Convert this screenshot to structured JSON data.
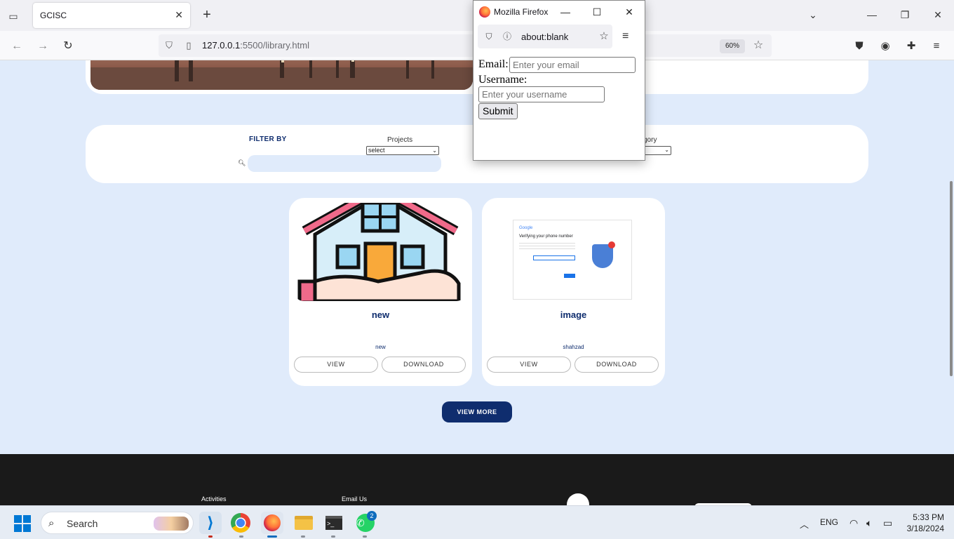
{
  "browser": {
    "tab_title": "GCISC",
    "url_host": "127.0.0.1",
    "url_rest": ":5500/library.html",
    "zoom": "60%"
  },
  "filter": {
    "title": "FILTER BY",
    "projects_label": "Projects",
    "projects_selected": "select",
    "category_label": "gory"
  },
  "cards": [
    {
      "title": "new",
      "author": "new",
      "view": "VIEW",
      "download": "DOWNLOAD"
    },
    {
      "title": "image",
      "author": "shahzad",
      "view": "VIEW",
      "download": "DOWNLOAD"
    }
  ],
  "thumbnail": {
    "heading": "Verifying your phone number",
    "brand": "Google"
  },
  "view_more": "VIEW MORE",
  "footer": {
    "activities": "Activities",
    "email_us": "Email Us"
  },
  "popup": {
    "window_title": "Mozilla Firefox",
    "url": "about:blank",
    "email_label": "Email:",
    "email_placeholder": "Enter your email",
    "username_label": "Username:",
    "username_placeholder": "Enter your username",
    "submit": "Submit"
  },
  "taskbar": {
    "search": "Search",
    "whatsapp_badge": "2",
    "lang": "ENG",
    "time": "5:33 PM",
    "date": "3/18/2024"
  },
  "colors": {
    "brand_navy": "#0f2d6e",
    "page_bg": "#e0ebfb"
  }
}
